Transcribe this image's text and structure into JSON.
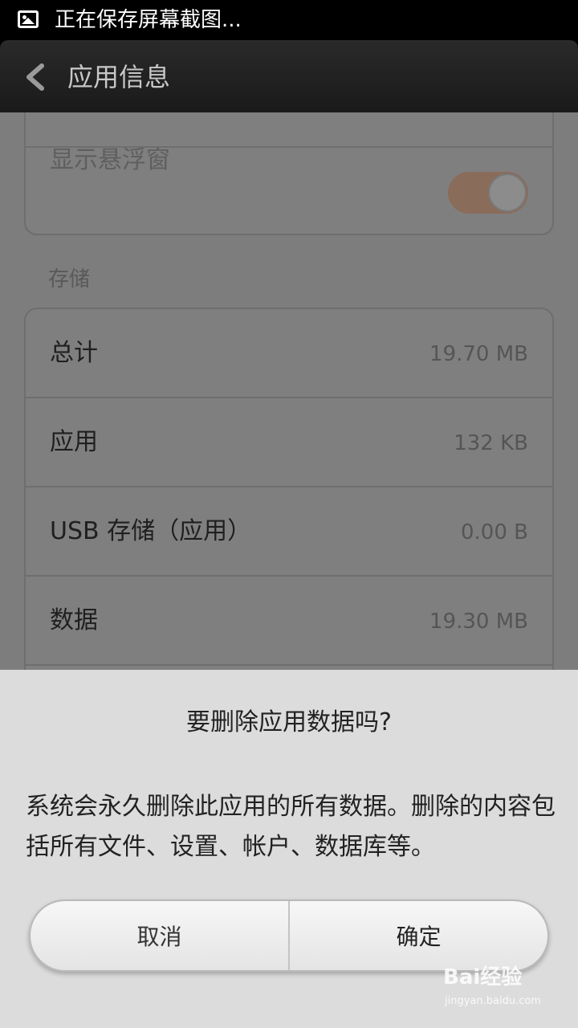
{
  "status_bar": {
    "text": "正在保存屏幕截图..."
  },
  "header": {
    "title": "应用信息"
  },
  "permissions": {
    "float_window_label": "显示悬浮窗"
  },
  "storage": {
    "section_label": "存储",
    "rows": [
      {
        "label": "总计",
        "value": "19.70 MB"
      },
      {
        "label": "应用",
        "value": "132 KB"
      },
      {
        "label": "USB 存储（应用）",
        "value": "0.00 B"
      },
      {
        "label": "数据",
        "value": "19.30 MB"
      }
    ]
  },
  "dialog": {
    "title": "要删除应用数据吗?",
    "message": "系统会永久删除此应用的所有数据。删除的内容包括所有文件、设置、帐户、数据库等。",
    "cancel_label": "取消",
    "confirm_label": "确定"
  },
  "watermark": {
    "brand": "Bai经验",
    "url": "jingyan.baidu.com"
  }
}
